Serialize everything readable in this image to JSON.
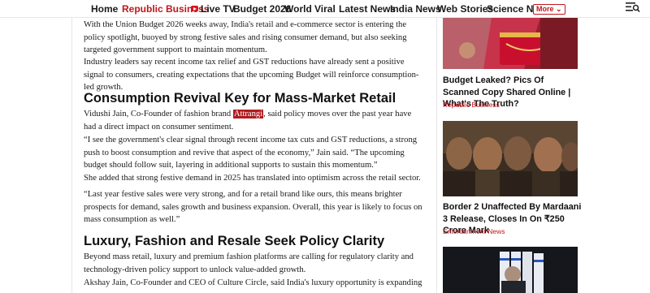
{
  "nav": {
    "items": [
      {
        "label": "Home",
        "active": false
      },
      {
        "label": "Republic Business",
        "active": true
      },
      {
        "label": "Live TV",
        "active": false
      },
      {
        "label": "Budget 2026",
        "active": false
      },
      {
        "label": "World",
        "active": false
      },
      {
        "label": "Viral",
        "active": false
      },
      {
        "label": "Latest News",
        "active": false
      },
      {
        "label": "India News",
        "active": false
      },
      {
        "label": "Web Stories",
        "active": false
      },
      {
        "label": "Science News",
        "active": false
      }
    ],
    "more_label": "More",
    "accent_color": "#c0161d"
  },
  "article": {
    "p1": "With the Union Budget 2026 weeks away, India's retail and e-commerce sector is entering the policy spotlight, buoyed by strong festive sales and rising consumer demand, but also seeking targeted government support to maintain momentum.",
    "p2": "Industry leaders say recent income tax relief and GST reductions have already sent a positive signal to consumers, creating expectations that the upcoming Budget will reinforce consumption-led growth.",
    "h1": "Consumption Revival Key for Mass-Market Retail",
    "p3_before": "Vidushi Jain, Co-Founder of fashion brand ",
    "p3_link": "Attrangi",
    "p3_after": ", said policy moves over the past year have had a direct impact on consumer sentiment.",
    "p4": "“I see the government's clear signal through recent income tax cuts and GST reductions, a strong push to boost consumption and revive that aspect of the economy,” Jain said. “The upcoming budget should follow suit, layering in additional supports to sustain this momentum.”",
    "p5": "She added that strong festive demand in 2025 has translated into optimism across the retail sector.",
    "p6": "“Last year festive sales were very strong, and for a retail brand like ours, this means brighter prospects for demand, sales growth and business expansion. Overall, this year is likely to focus on mass consumption as well.”",
    "h2": "Luxury, Fashion and Resale Seek Policy Clarity",
    "p7": "Beyond mass retail, luxury and premium fashion platforms are calling for regulatory clarity and technology-driven policy support to unlock value-added growth.",
    "p8": "Akshay Jain, Co-Founder and CEO of Culture Circle, said India's luxury opportunity is expanding"
  },
  "sidebar": {
    "cards": [
      {
        "title": "",
        "category": ""
      },
      {
        "title": "Budget Leaked? Pics Of Scanned Copy Shared Online | What's The Truth?",
        "category": "Republic Business"
      },
      {
        "title": "Border 2 Unaffected By Mardaani 3 Release, Closes In On ₹250 Crore Mark",
        "category": "Entertainment News"
      }
    ]
  }
}
